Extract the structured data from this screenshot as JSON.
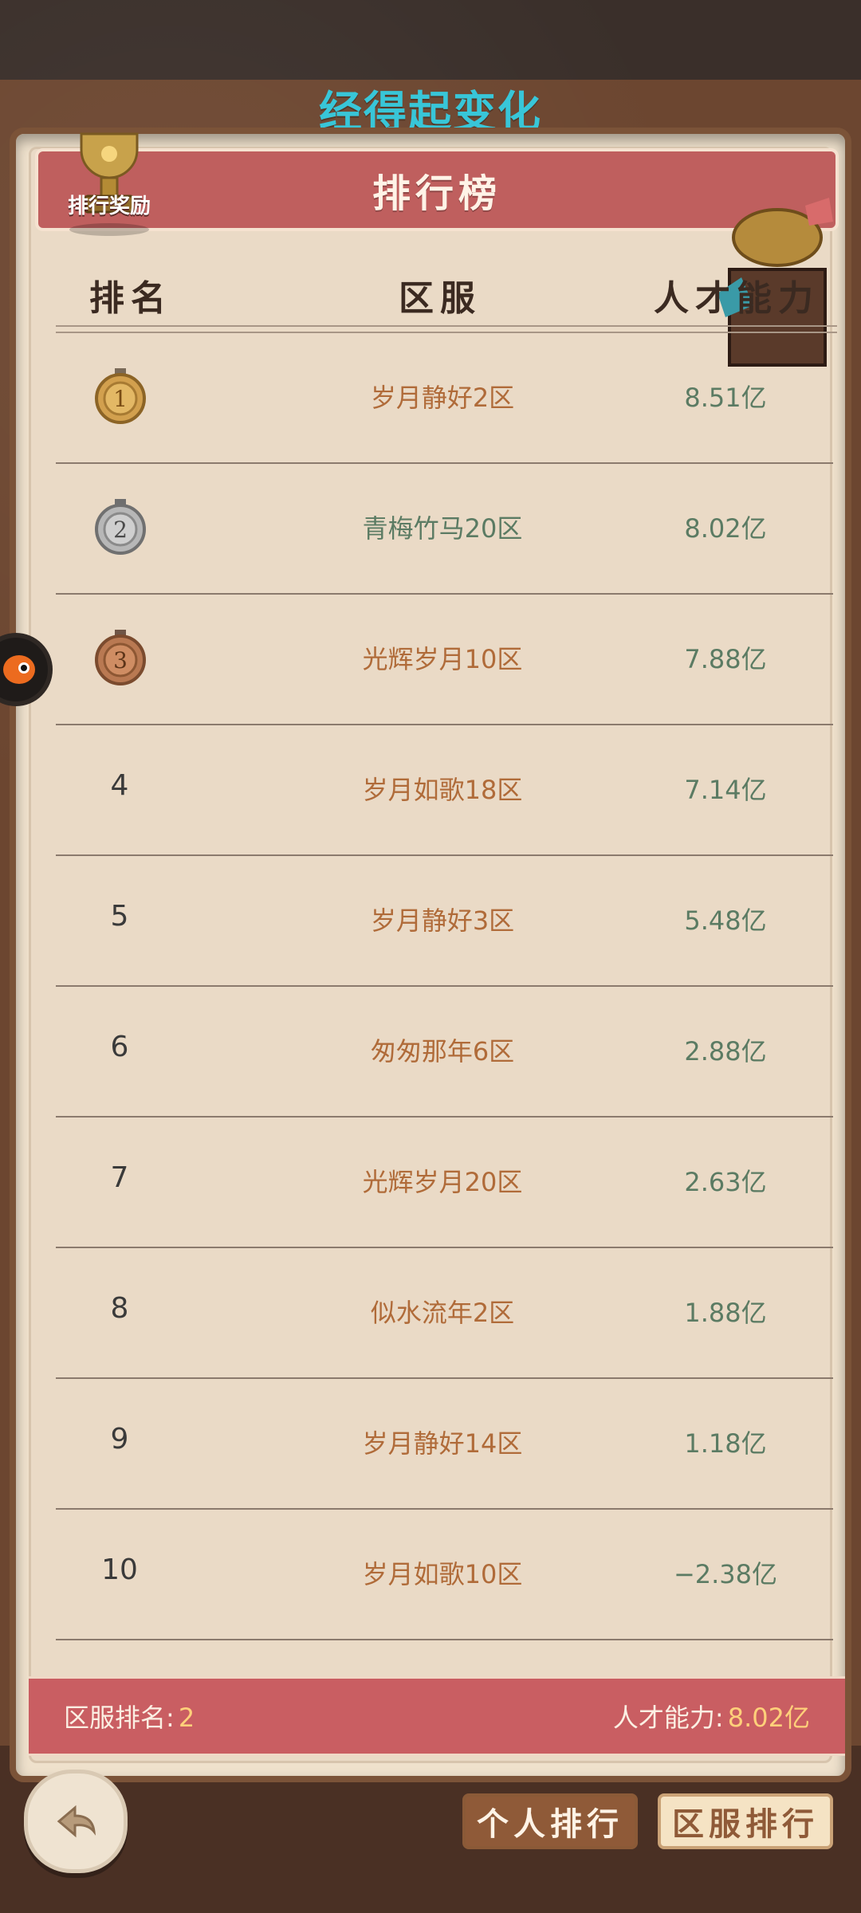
{
  "banner": {
    "text": "经得起变化"
  },
  "header": {
    "title": "排行榜",
    "reward_label": "排行奖励"
  },
  "columns": {
    "rank": "排名",
    "server": "区服",
    "power": "人才能力"
  },
  "rows": [
    {
      "rank": "1",
      "server": "岁月静好2区",
      "power": "8.51亿",
      "medal": "gold"
    },
    {
      "rank": "2",
      "server": "青梅竹马20区",
      "power": "8.02亿",
      "medal": "silver"
    },
    {
      "rank": "3",
      "server": "光辉岁月10区",
      "power": "7.88亿",
      "medal": "bronze"
    },
    {
      "rank": "4",
      "server": "岁月如歌18区",
      "power": "7.14亿"
    },
    {
      "rank": "5",
      "server": "岁月静好3区",
      "power": "5.48亿"
    },
    {
      "rank": "6",
      "server": "匆匆那年6区",
      "power": "2.88亿"
    },
    {
      "rank": "7",
      "server": "光辉岁月20区",
      "power": "2.63亿"
    },
    {
      "rank": "8",
      "server": "似水流年2区",
      "power": "1.88亿"
    },
    {
      "rank": "9",
      "server": "岁月静好14区",
      "power": "1.18亿"
    },
    {
      "rank": "10",
      "server": "岁月如歌10区",
      "power": "−2.38亿"
    }
  ],
  "footer": {
    "server_rank_label": "区服排名:",
    "server_rank_value": "2",
    "power_label": "人才能力:",
    "power_value": "8.02亿"
  },
  "buttons": {
    "personal": "个人排行",
    "server": "区服排行"
  },
  "colors": {
    "accent_red": "#c95e62",
    "highlight_green": "#5b7b63",
    "server_brown": "#b06b39"
  }
}
